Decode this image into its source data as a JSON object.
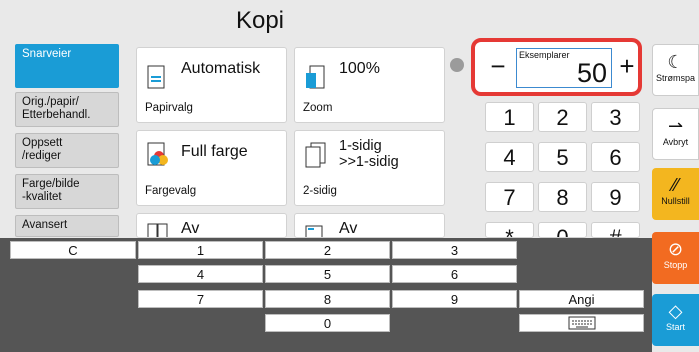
{
  "title": "Kopi",
  "sidebar": {
    "items": [
      {
        "label": "Snarveier",
        "active": true
      },
      {
        "label": "Orig./papir/\nEtterbehandl."
      },
      {
        "label": "Oppsett\n/rediger"
      },
      {
        "label": "Farge/bilde\n-kvalitet"
      },
      {
        "label": "Avansert"
      }
    ]
  },
  "cards": [
    {
      "main": "Automatisk",
      "sub": "Papirvalg",
      "icon": "paper-tray-icon"
    },
    {
      "main": "100%",
      "sub": "Zoom",
      "icon": "zoom-icon"
    },
    {
      "main": "Full farge",
      "sub": "Fargevalg",
      "icon": "color-icon"
    },
    {
      "main": "1-sidig\n>>1-sidig",
      "sub": "2-sidig",
      "icon": "duplex-icon"
    },
    {
      "main": "Av",
      "sub": "",
      "icon": "combine-icon"
    },
    {
      "main": "Av",
      "sub": "",
      "icon": "staple-icon"
    }
  ],
  "copies": {
    "label": "Eksemplarer",
    "value": "50",
    "minus": "−",
    "plus": "+"
  },
  "keypad": [
    "1",
    "2",
    "3",
    "4",
    "5",
    "6",
    "7",
    "8",
    "9",
    "*",
    "0",
    "#"
  ],
  "right": {
    "power": "Strømspa",
    "cancel": "Avbryt",
    "quality": "Nullstill",
    "stop": "Stopp",
    "start": "Start"
  },
  "bottom_keys": {
    "c": "C",
    "n1": "1",
    "n2": "2",
    "n3": "3",
    "n4": "4",
    "n5": "5",
    "n6": "6",
    "n7": "7",
    "n8": "8",
    "n9": "9",
    "n0": "0",
    "enter": "Angi"
  },
  "colors": {
    "accent": "#1a9cd6",
    "stop": "#f26b21",
    "start": "#1a9cd6",
    "reset": "#f3b61f",
    "highlight": "#e53935"
  }
}
